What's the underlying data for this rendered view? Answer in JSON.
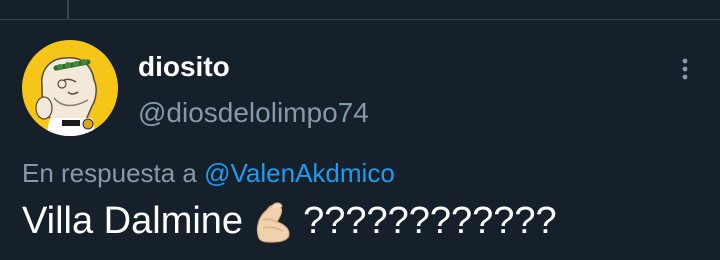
{
  "tweet": {
    "display_name": "diosito",
    "handle": "@diosdelolimpo74",
    "reply_prefix": "En respuesta a",
    "reply_mention": "@ValenAkdmico",
    "text_main": "Villa Dalmine",
    "text_emoji": "pinched-fingers-emoji",
    "text_suffix": "????????????"
  },
  "icons": {
    "more": "more-options-icon",
    "avatar": "avatar"
  },
  "colors": {
    "background": "#15202b",
    "primary_text": "#ffffff",
    "secondary_text": "#8899a6",
    "link": "#1d9bf0",
    "avatar_bg": "#f5c518",
    "divider": "#38444d"
  }
}
